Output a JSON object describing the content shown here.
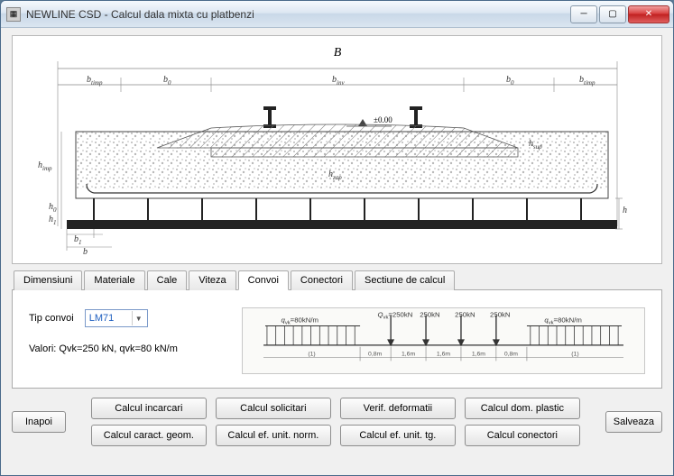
{
  "window": {
    "title": "NEWLINE CSD - Calcul dala mixta cu platbenzi"
  },
  "diagram": {
    "top_label_B": "B",
    "b_timp_l": "b",
    "b_timp_l_sub": "timp",
    "b0_l": "b",
    "b0_l_sub": "0",
    "b_inv": "b",
    "b_inv_sub": "inv",
    "b0_r": "b",
    "b0_r_sub": "0",
    "b_timp_r": "b",
    "b_timp_r_sub": "timp",
    "zero_level": "±0.00",
    "h_sup": "h",
    "h_sup_sub": "sup",
    "h_imp": "h",
    "h_imp_sub": "imp",
    "h_zap": "h",
    "h_zap_sub": "zap",
    "h0": "h",
    "h0_sub": "0",
    "h1": "h",
    "h1_sub": "1",
    "h": "h",
    "b1": "b",
    "b1_sub": "1",
    "b": "b"
  },
  "tabs": {
    "t0": "Dimensiuni",
    "t1": "Materiale",
    "t2": "Cale",
    "t3": "Viteza",
    "t4": "Convoi",
    "t5": "Conectori",
    "t6": "Sectiune de calcul"
  },
  "convoi": {
    "tip_label": "Tip convoi",
    "tip_value": "LM71",
    "valori": "Valori: Qvk=250 kN, qvk=80 kN/m",
    "q_left": "q",
    "q_left_sub": "vk",
    "q_left_val": "=80kN/m",
    "Q_main": "Q",
    "Q_main_sub": "vk",
    "Q_val1": "=250kN",
    "Q_val2": "250kN",
    "Q_val3": "250kN",
    "Q_val4": "250kN",
    "q_right": "q",
    "q_right_sub": "vk",
    "q_right_val": "=80kN/m",
    "dim_08a": "0,8m",
    "dim_16a": "1,6m",
    "dim_16b": "1,6m",
    "dim_16c": "1,6m",
    "dim_08b": "0,8m",
    "inf": "(1)",
    "inf2": "(1)"
  },
  "buttons": {
    "inapoi": "Inapoi",
    "b0": "Calcul incarcari",
    "b1": "Calcul solicitari",
    "b2": "Verif. deformatii",
    "b3": "Calcul dom. plastic",
    "b4": "Calcul caract. geom.",
    "b5": "Calcul ef. unit. norm.",
    "b6": "Calcul ef. unit. tg.",
    "b7": "Calcul conectori",
    "salveaza": "Salveaza"
  }
}
